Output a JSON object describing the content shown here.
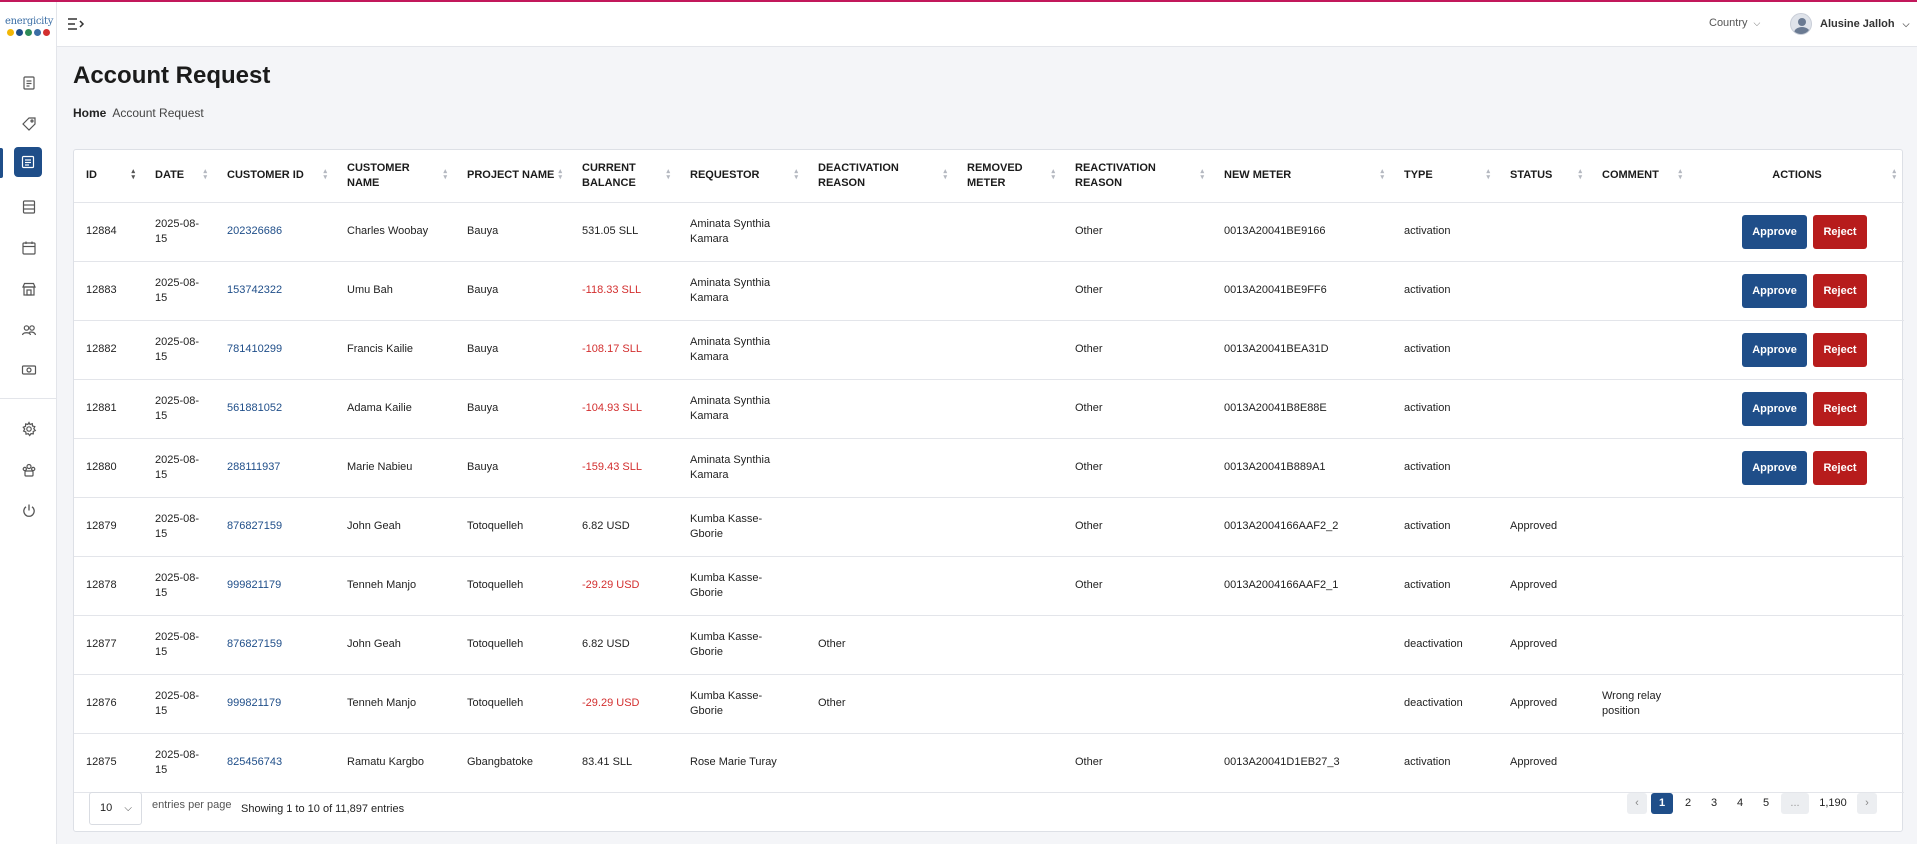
{
  "app": {
    "logo_text": "energicity",
    "logo_colors": [
      "#f2b705",
      "#1f4e89",
      "#2e8b57",
      "#3b6ea5",
      "#d32f2f"
    ],
    "accent": "#1f4e89",
    "danger": "#b71c1c",
    "top_line_color": "#c2185b"
  },
  "sidebar": {
    "items": [
      {
        "icon": "document-icon"
      },
      {
        "icon": "tag-icon"
      },
      {
        "icon": "account-request-icon",
        "active": true
      },
      {
        "icon": "table-icon"
      },
      {
        "icon": "calendar-icon"
      },
      {
        "icon": "store-icon"
      },
      {
        "icon": "users-icon"
      },
      {
        "icon": "cash-icon"
      },
      {
        "icon": "settings-icon"
      },
      {
        "icon": "team-icon"
      },
      {
        "icon": "power-icon"
      }
    ]
  },
  "header": {
    "country_label": "Country",
    "user_name": "Alusine Jalloh"
  },
  "page": {
    "title": "Account Request",
    "breadcrumb": {
      "home": "Home",
      "current": "Account Request"
    }
  },
  "table": {
    "columns": [
      "ID",
      "DATE",
      "CUSTOMER ID",
      "CUSTOMER NAME",
      "PROJECT NAME",
      "CURRENT BALANCE",
      "REQUESTOR",
      "DEACTIVATION REASON",
      "REMOVED METER",
      "REACTIVATION REASON",
      "NEW METER",
      "TYPE",
      "STATUS",
      "COMMENT",
      "ACTIONS"
    ],
    "approve_label": "Approve",
    "reject_label": "Reject",
    "rows": [
      {
        "id": "12884",
        "date": "2025-08-15",
        "customer_id": "202326686",
        "customer_name": "Charles Woobay",
        "project": "Bauya",
        "balance": "531.05 SLL",
        "negative": false,
        "requestor": "Aminata Synthia Kamara",
        "deactivation_reason": "",
        "removed_meter": "",
        "reactivation_reason": "Other",
        "new_meter": "0013A20041BE9166",
        "type": "activation",
        "status": "",
        "comment": "",
        "actions": true
      },
      {
        "id": "12883",
        "date": "2025-08-15",
        "customer_id": "153742322",
        "customer_name": "Umu Bah",
        "project": "Bauya",
        "balance": "-118.33 SLL",
        "negative": true,
        "requestor": "Aminata Synthia Kamara",
        "deactivation_reason": "",
        "removed_meter": "",
        "reactivation_reason": "Other",
        "new_meter": "0013A20041BE9FF6",
        "type": "activation",
        "status": "",
        "comment": "",
        "actions": true
      },
      {
        "id": "12882",
        "date": "2025-08-15",
        "customer_id": "781410299",
        "customer_name": "Francis Kailie",
        "project": "Bauya",
        "balance": "-108.17 SLL",
        "negative": true,
        "requestor": "Aminata Synthia Kamara",
        "deactivation_reason": "",
        "removed_meter": "",
        "reactivation_reason": "Other",
        "new_meter": "0013A20041BEA31D",
        "type": "activation",
        "status": "",
        "comment": "",
        "actions": true
      },
      {
        "id": "12881",
        "date": "2025-08-15",
        "customer_id": "561881052",
        "customer_name": "Adama Kailie",
        "project": "Bauya",
        "balance": "-104.93 SLL",
        "negative": true,
        "requestor": "Aminata Synthia Kamara",
        "deactivation_reason": "",
        "removed_meter": "",
        "reactivation_reason": "Other",
        "new_meter": "0013A20041B8E88E",
        "type": "activation",
        "status": "",
        "comment": "",
        "actions": true
      },
      {
        "id": "12880",
        "date": "2025-08-15",
        "customer_id": "288111937",
        "customer_name": "Marie Nabieu",
        "project": "Bauya",
        "balance": "-159.43 SLL",
        "negative": true,
        "requestor": "Aminata Synthia Kamara",
        "deactivation_reason": "",
        "removed_meter": "",
        "reactivation_reason": "Other",
        "new_meter": "0013A20041B889A1",
        "type": "activation",
        "status": "",
        "comment": "",
        "actions": true
      },
      {
        "id": "12879",
        "date": "2025-08-15",
        "customer_id": "876827159",
        "customer_name": "John Geah",
        "project": "Totoquelleh",
        "balance": "6.82 USD",
        "negative": false,
        "requestor": "Kumba Kasse-Gborie",
        "deactivation_reason": "",
        "removed_meter": "",
        "reactivation_reason": "Other",
        "new_meter": "0013A2004166AAF2_2",
        "type": "activation",
        "status": "Approved",
        "comment": "",
        "actions": false
      },
      {
        "id": "12878",
        "date": "2025-08-15",
        "customer_id": "999821179",
        "customer_name": "Tenneh Manjo",
        "project": "Totoquelleh",
        "balance": "-29.29 USD",
        "negative": true,
        "requestor": "Kumba Kasse-Gborie",
        "deactivation_reason": "",
        "removed_meter": "",
        "reactivation_reason": "Other",
        "new_meter": "0013A2004166AAF2_1",
        "type": "activation",
        "status": "Approved",
        "comment": "",
        "actions": false
      },
      {
        "id": "12877",
        "date": "2025-08-15",
        "customer_id": "876827159",
        "customer_name": "John Geah",
        "project": "Totoquelleh",
        "balance": "6.82 USD",
        "negative": false,
        "requestor": "Kumba Kasse-Gborie",
        "deactivation_reason": "Other",
        "removed_meter": "",
        "reactivation_reason": "",
        "new_meter": "",
        "type": "deactivation",
        "status": "Approved",
        "comment": "",
        "actions": false
      },
      {
        "id": "12876",
        "date": "2025-08-15",
        "customer_id": "999821179",
        "customer_name": "Tenneh Manjo",
        "project": "Totoquelleh",
        "balance": "-29.29 USD",
        "negative": true,
        "requestor": "Kumba Kasse-Gborie",
        "deactivation_reason": "Other",
        "removed_meter": "",
        "reactivation_reason": "",
        "new_meter": "",
        "type": "deactivation",
        "status": "Approved",
        "comment": "Wrong relay position",
        "actions": false
      },
      {
        "id": "12875",
        "date": "2025-08-15",
        "customer_id": "825456743",
        "customer_name": "Ramatu Kargbo",
        "project": "Gbangbatoke",
        "balance": "83.41 SLL",
        "negative": false,
        "requestor": "Rose Marie Turay",
        "deactivation_reason": "",
        "removed_meter": "",
        "reactivation_reason": "Other",
        "new_meter": "0013A20041D1EB27_3",
        "type": "activation",
        "status": "Approved",
        "comment": "",
        "actions": false
      }
    ]
  },
  "pagination": {
    "per_page": "10",
    "per_page_label": "entries per page",
    "showing": "Showing 1 to 10 of 11,897 entries",
    "prev": "‹",
    "next": "›",
    "pages": [
      "1",
      "2",
      "3",
      "4",
      "5",
      "...",
      "1,190"
    ],
    "active_page": "1"
  }
}
